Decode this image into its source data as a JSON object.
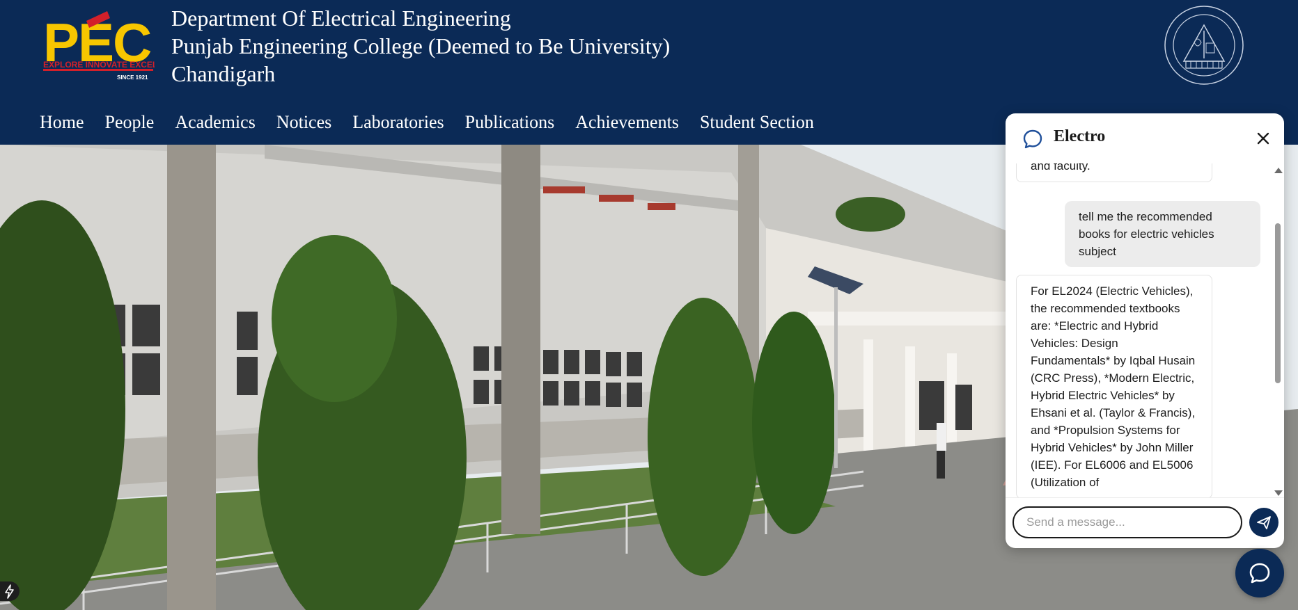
{
  "header": {
    "logo_text": "PEC",
    "logo_tagline": "EXPLORE INNOVATE EXCEL",
    "logo_since": "SINCE 1921",
    "title_line1": "Department Of Electrical Engineering",
    "title_line2": "Punjab Engineering College (Deemed to Be University)",
    "title_line3": "Chandigarh"
  },
  "nav": {
    "items": [
      {
        "label": "Home"
      },
      {
        "label": "People"
      },
      {
        "label": "Academics"
      },
      {
        "label": "Notices"
      },
      {
        "label": "Laboratories"
      },
      {
        "label": "Publications"
      },
      {
        "label": "Achievements"
      },
      {
        "label": "Student Section"
      }
    ]
  },
  "chat": {
    "title": "Electro",
    "messages": [
      {
        "role": "bot",
        "text": "and faculty."
      },
      {
        "role": "user",
        "text": "tell me the recommended books for electric vehicles subject"
      },
      {
        "role": "bot",
        "text": "For EL2024 (Electric Vehicles), the recommended textbooks are: *Electric and Hybrid Vehicles: Design Fundamentals* by Iqbal Husain (CRC Press), *Modern Electric, Hybrid Electric Vehicles* by Ehsani et al. (Taylor & Francis), and *Propulsion Systems for Hybrid Vehicles* by John Miller (IEE). For EL6006 and EL5006 (Utilization of"
      }
    ],
    "input_placeholder": "Send a message...",
    "input_value": ""
  },
  "colors": {
    "brand_navy": "#0b2a56",
    "logo_yellow": "#f7c600",
    "logo_red": "#d3202a"
  },
  "icons": {
    "chat_header": "chat-bubble-icon",
    "close": "close-icon",
    "send": "send-icon",
    "fab": "chat-bubble-icon",
    "corner": "bolt-icon"
  }
}
